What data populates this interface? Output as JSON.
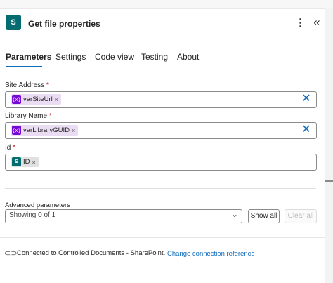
{
  "header": {
    "app_icon_letter": "S",
    "title": "Get file properties",
    "more_icon": "⋮",
    "collapse_icon": "«"
  },
  "tabs": [
    {
      "label": "Parameters",
      "active": true
    },
    {
      "label": "Settings"
    },
    {
      "label": "Code view"
    },
    {
      "label": "Testing"
    },
    {
      "label": "About"
    }
  ],
  "fields": {
    "site_address": {
      "label": "Site Address",
      "required": "*",
      "token_icon": "{x}",
      "token": "varSiteUrl",
      "token_remove": "×",
      "clear_icon": "✕"
    },
    "library_name": {
      "label": "Library Name",
      "required": "*",
      "token_icon": "{x}",
      "token": "varLibraryGUID",
      "token_remove": "×",
      "clear_icon": "✕"
    },
    "id": {
      "label": "Id",
      "required": "*",
      "token_icon": "S",
      "token": "ID",
      "token_remove": "×"
    }
  },
  "advanced": {
    "label": "Advanced parameters",
    "select_value": "Showing 0 of 1",
    "chevron": "⌄",
    "show_all": "Show all",
    "clear_all": "Clear all"
  },
  "connection": {
    "icon": "⊂⊃",
    "text": "Connected to Controlled Documents - SharePoint.",
    "link": "Change connection reference"
  },
  "colors": {
    "accent": "#0f6cbd",
    "sharepoint": "#036c70",
    "variable": "#770bd6",
    "required": "#c50f1f"
  }
}
